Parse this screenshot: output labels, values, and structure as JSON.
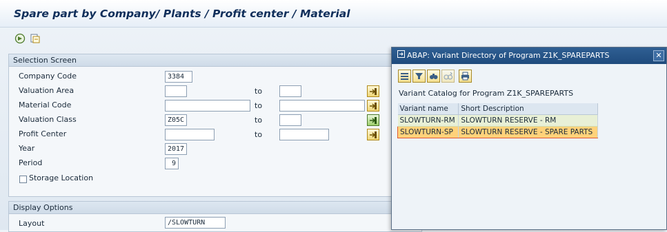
{
  "window": {
    "title": "Spare part by Company/ Plants / Profit center / Material"
  },
  "toolbar": {
    "execute_icon": "execute-icon",
    "variant_icon": "get-variant-icon"
  },
  "selection": {
    "header": "Selection Screen",
    "fields": [
      {
        "label": "Company Code",
        "low": "3384"
      },
      {
        "label": "Valuation Area",
        "low": "",
        "to": "to",
        "high": ""
      },
      {
        "label": "Material Code",
        "low": "",
        "to": "to",
        "high": ""
      },
      {
        "label": "Valuation Class",
        "low": "Z05C",
        "to": "to",
        "high": ""
      },
      {
        "label": "Profit Center",
        "low": "",
        "to": "to",
        "high": ""
      },
      {
        "label": "Year",
        "low": "2017"
      },
      {
        "label": "Period",
        "low": "9"
      }
    ],
    "storage_location_label": "Storage Location",
    "storage_location_checked": false
  },
  "display": {
    "header": "Display Options",
    "layout_label": "Layout",
    "layout_value": "/SLOWTURN"
  },
  "dialog": {
    "title": "ABAP: Variant Directory of Program Z1K_SPAREPARTS",
    "close_glyph": "✕",
    "catalog_label": "Variant Catalog for Program Z1K_SPAREPARTS",
    "columns": [
      "Variant name",
      "Short Description"
    ],
    "rows": [
      {
        "name": "SLOWTURN-RM",
        "desc": "SLOWTURN RESERVE - RM"
      },
      {
        "name": "SLOWTURN-SP",
        "desc": "SLOWTURN RESERVE - SPARE PARTS"
      }
    ],
    "selected_row": 1
  }
}
